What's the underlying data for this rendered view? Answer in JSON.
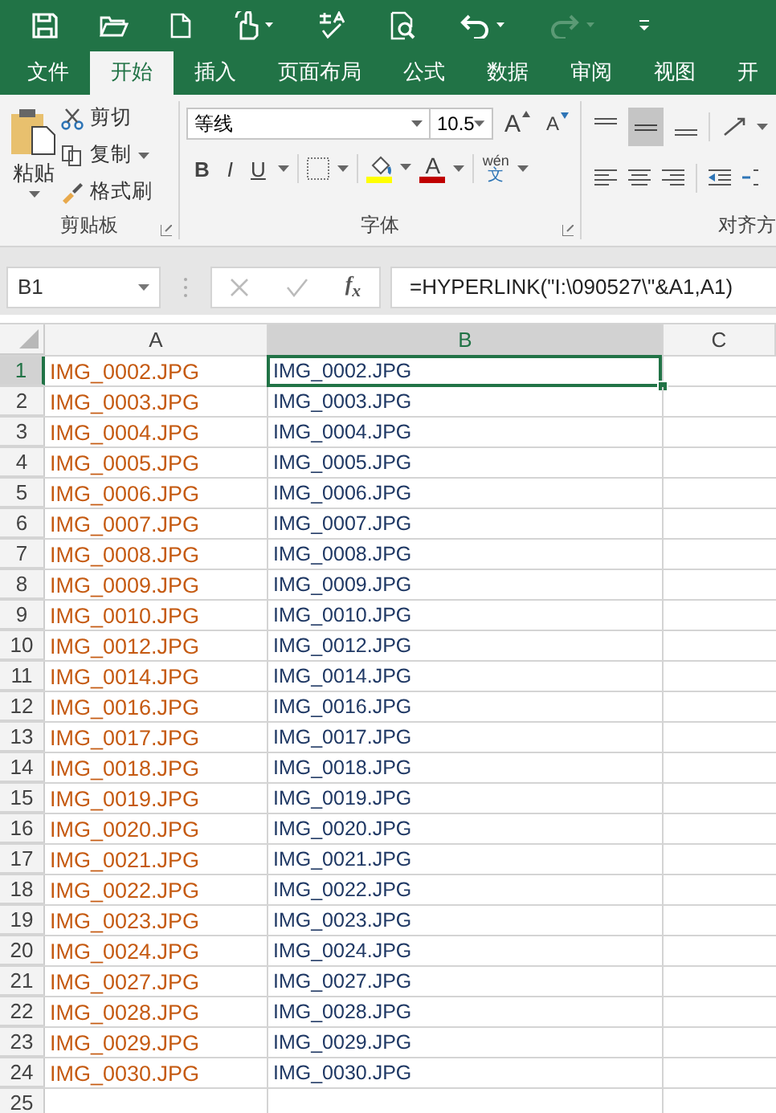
{
  "ribbon_tabs": [
    {
      "label": "文件",
      "selected": false
    },
    {
      "label": "开始",
      "selected": true
    },
    {
      "label": "插入",
      "selected": false
    },
    {
      "label": "页面布局",
      "selected": false
    },
    {
      "label": "公式",
      "selected": false
    },
    {
      "label": "数据",
      "selected": false
    },
    {
      "label": "审阅",
      "selected": false
    },
    {
      "label": "视图",
      "selected": false
    },
    {
      "label": "开",
      "selected": false
    }
  ],
  "clipboard": {
    "paste": "粘贴",
    "cut": "剪切",
    "copy": "复制",
    "format_painter": "格式刷",
    "group_label": "剪贴板"
  },
  "font": {
    "name": "等线",
    "size": "10.5",
    "grow": "A",
    "shrink": "A",
    "bold": "B",
    "italic": "I",
    "underline": "U",
    "font_color": "A",
    "phonetic_top": "wén",
    "phonetic_bottom": "文",
    "group_label": "字体"
  },
  "alignment": {
    "group_label": "对齐方"
  },
  "name_box": "B1",
  "fx": "f$_{x}$",
  "formula": "=HYPERLINK(\"I:\\090527\\\"&A1,A1)",
  "columns": [
    {
      "label": "A",
      "selected": false
    },
    {
      "label": "B",
      "selected": true
    },
    {
      "label": "C",
      "selected": false
    }
  ],
  "rows": [
    {
      "number": "1",
      "a": "IMG_0002.JPG",
      "b": "IMG_0002.JPG",
      "selected": true
    },
    {
      "number": "2",
      "a": "IMG_0003.JPG",
      "b": "IMG_0003.JPG",
      "selected": false
    },
    {
      "number": "3",
      "a": "IMG_0004.JPG",
      "b": "IMG_0004.JPG",
      "selected": false
    },
    {
      "number": "4",
      "a": "IMG_0005.JPG",
      "b": "IMG_0005.JPG",
      "selected": false
    },
    {
      "number": "5",
      "a": "IMG_0006.JPG",
      "b": "IMG_0006.JPG",
      "selected": false
    },
    {
      "number": "6",
      "a": "IMG_0007.JPG",
      "b": "IMG_0007.JPG",
      "selected": false
    },
    {
      "number": "7",
      "a": "IMG_0008.JPG",
      "b": "IMG_0008.JPG",
      "selected": false
    },
    {
      "number": "8",
      "a": "IMG_0009.JPG",
      "b": "IMG_0009.JPG",
      "selected": false
    },
    {
      "number": "9",
      "a": "IMG_0010.JPG",
      "b": "IMG_0010.JPG",
      "selected": false
    },
    {
      "number": "10",
      "a": "IMG_0012.JPG",
      "b": "IMG_0012.JPG",
      "selected": false
    },
    {
      "number": "11",
      "a": "IMG_0014.JPG",
      "b": "IMG_0014.JPG",
      "selected": false
    },
    {
      "number": "12",
      "a": "IMG_0016.JPG",
      "b": "IMG_0016.JPG",
      "selected": false
    },
    {
      "number": "13",
      "a": "IMG_0017.JPG",
      "b": "IMG_0017.JPG",
      "selected": false
    },
    {
      "number": "14",
      "a": "IMG_0018.JPG",
      "b": "IMG_0018.JPG",
      "selected": false
    },
    {
      "number": "15",
      "a": "IMG_0019.JPG",
      "b": "IMG_0019.JPG",
      "selected": false
    },
    {
      "number": "16",
      "a": "IMG_0020.JPG",
      "b": "IMG_0020.JPG",
      "selected": false
    },
    {
      "number": "17",
      "a": "IMG_0021.JPG",
      "b": "IMG_0021.JPG",
      "selected": false
    },
    {
      "number": "18",
      "a": "IMG_0022.JPG",
      "b": "IMG_0022.JPG",
      "selected": false
    },
    {
      "number": "19",
      "a": "IMG_0023.JPG",
      "b": "IMG_0023.JPG",
      "selected": false
    },
    {
      "number": "20",
      "a": "IMG_0024.JPG",
      "b": "IMG_0024.JPG",
      "selected": false
    },
    {
      "number": "21",
      "a": "IMG_0027.JPG",
      "b": "IMG_0027.JPG",
      "selected": false
    },
    {
      "number": "22",
      "a": "IMG_0028.JPG",
      "b": "IMG_0028.JPG",
      "selected": false
    },
    {
      "number": "23",
      "a": "IMG_0029.JPG",
      "b": "IMG_0029.JPG",
      "selected": false
    },
    {
      "number": "24",
      "a": "IMG_0030.JPG",
      "b": "IMG_0030.JPG",
      "selected": false
    },
    {
      "number": "25",
      "selected": false
    }
  ]
}
